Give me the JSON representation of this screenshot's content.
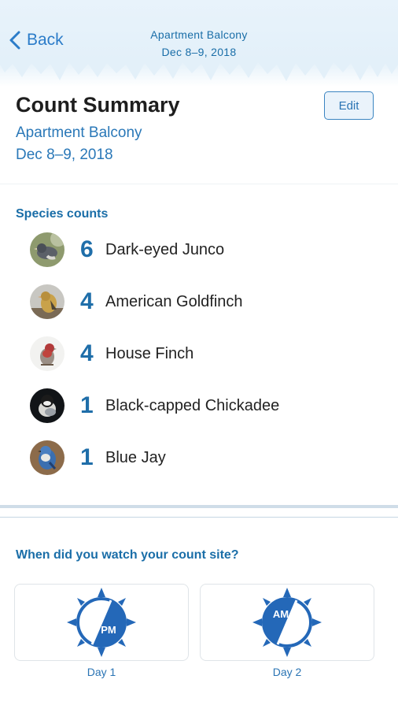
{
  "nav": {
    "back_label": "Back",
    "title": "Apartment Balcony",
    "subtitle": "Dec 8–9, 2018"
  },
  "summary": {
    "title": "Count Summary",
    "edit_label": "Edit",
    "site_name": "Apartment Balcony",
    "site_dates": "Dec 8–9, 2018"
  },
  "species_section": {
    "label": "Species counts",
    "items": [
      {
        "count": "6",
        "name": "Dark-eyed Junco",
        "photo": "dark-eyed-junco-photo"
      },
      {
        "count": "4",
        "name": "American Goldfinch",
        "photo": "american-goldfinch-photo"
      },
      {
        "count": "4",
        "name": "House Finch",
        "photo": "house-finch-photo"
      },
      {
        "count": "1",
        "name": "Black-capped Chickadee",
        "photo": "black-capped-chickadee-photo"
      },
      {
        "count": "1",
        "name": "Blue Jay",
        "photo": "blue-jay-photo"
      }
    ]
  },
  "watch_section": {
    "question": "When did you watch your count site?",
    "days": [
      {
        "label": "Day 1",
        "period": "PM",
        "icon": "sun-dial-icon"
      },
      {
        "label": "Day 2",
        "period": "AM",
        "icon": "sun-dial-icon"
      }
    ]
  },
  "colors": {
    "accent": "#2b7cc9",
    "count_blue": "#1f6ea9",
    "dial_blue": "#2468b8",
    "header_bg": "#e3f0f9"
  }
}
